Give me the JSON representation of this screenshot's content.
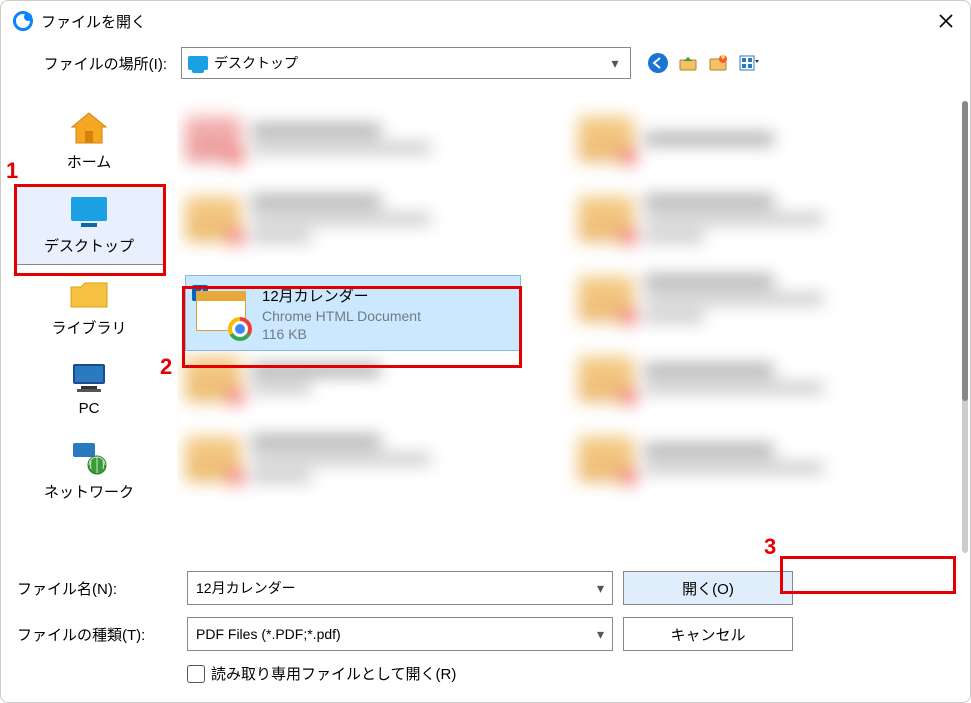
{
  "window": {
    "title": "ファイルを開く"
  },
  "location": {
    "label": "ファイルの場所(I):",
    "value": "デスクトップ"
  },
  "places": [
    {
      "id": "home",
      "label": "ホーム"
    },
    {
      "id": "desktop",
      "label": "デスクトップ",
      "selected": true
    },
    {
      "id": "library",
      "label": "ライブラリ"
    },
    {
      "id": "pc",
      "label": "PC"
    },
    {
      "id": "network",
      "label": "ネットワーク"
    }
  ],
  "nav_icons": {
    "back": "back-arrow",
    "up": "up-level",
    "newdir": "new-folder",
    "view": "view-menu"
  },
  "selected_file": {
    "name": "12月カレンダー",
    "type": "Chrome HTML Document",
    "size": "116 KB",
    "checked": true
  },
  "filename": {
    "label": "ファイル名(N):",
    "value": "12月カレンダー"
  },
  "filetype": {
    "label": "ファイルの種類(T):",
    "value": "PDF Files (*.PDF;*.pdf)"
  },
  "readonly": {
    "label": "読み取り専用ファイルとして開く(R)",
    "checked": false
  },
  "buttons": {
    "open": "開く(O)",
    "cancel": "キャンセル"
  },
  "annotations": {
    "n1": "1",
    "n2": "2",
    "n3": "3"
  }
}
